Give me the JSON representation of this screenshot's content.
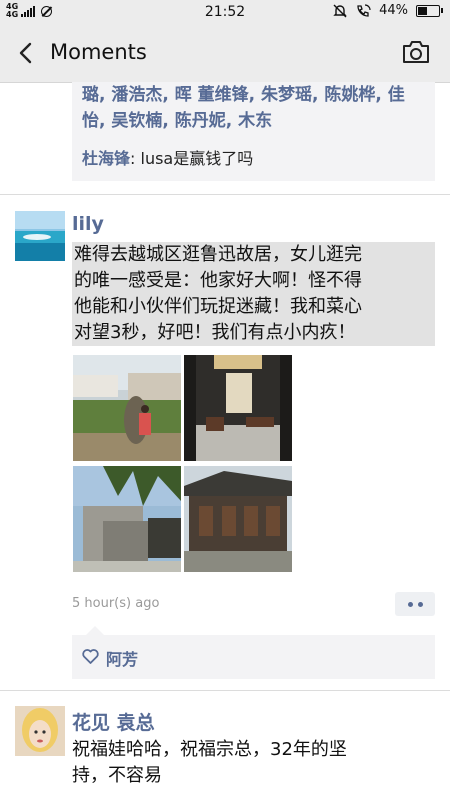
{
  "status_bar": {
    "network": "4G",
    "network2": "4G",
    "time": "21:52",
    "battery": "44%",
    "battery_level": 0.44
  },
  "nav": {
    "title": "Moments"
  },
  "prev_post": {
    "like_lines": [
      "璐, 潘浩杰, 晖 董维锋, 朱梦瑶, 陈姚桦, 佳",
      "怡, 吴钦楠, 陈丹妮, 木东"
    ],
    "comment": {
      "author": "杜海锋",
      "text": ": lusa是赢钱了吗"
    }
  },
  "post": {
    "username": "lily",
    "text": "难得去越城区逛鲁迅故居，女儿逛完的唯一感受是：他家好大啊！怪不得他能和小伙伴们玩捉迷藏！我和菜心对望3秒，好吧！我们有点小内疚！",
    "text_lines": [
      "难得去越城区逛鲁迅故居，女儿逛完",
      "的唯一感受是：他家好大啊！怪不得",
      "他能和小伙伴们玩捉迷藏！我和菜心",
      "对望3秒，好吧！我们有点小内疚！"
    ],
    "timestamp": "5 hour(s) ago",
    "likes": [
      "阿芳"
    ]
  },
  "next_post": {
    "username": "花见  袁总",
    "text_lines": [
      "祝福娃哈哈，祝福宗总，32年的坚",
      "持，不容易"
    ]
  },
  "icons": [
    "back-icon",
    "camera-icon",
    "heart-icon",
    "more-icon"
  ],
  "colors": {
    "link": "#576b95",
    "bar": "#ececec",
    "comment_bg": "#f3f3f5",
    "highlight": "#e2e2e2"
  }
}
